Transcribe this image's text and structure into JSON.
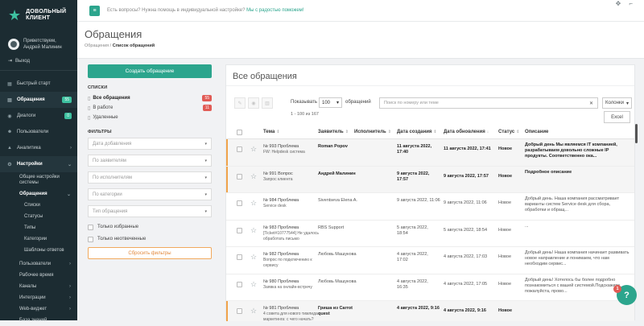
{
  "brand": {
    "line1": "ДОВОЛЬНЫЙ",
    "line2": "КЛИЕНТ"
  },
  "user": {
    "greeting": "Приветствуем,",
    "name": "Андрей Малинин",
    "logout": "Выход"
  },
  "sidebar": {
    "items": [
      {
        "label": "Быстрый старт",
        "icon": "grid-icon"
      },
      {
        "label": "Обращения",
        "icon": "inbox-icon",
        "badge": "55",
        "active": true
      },
      {
        "label": "Диалоги",
        "icon": "chat-icon",
        "badge": "0"
      },
      {
        "label": "Пользователи",
        "icon": "users-icon"
      },
      {
        "label": "Аналитика",
        "icon": "chart-icon"
      },
      {
        "label": "Настройки",
        "icon": "gear-icon",
        "active": true
      }
    ],
    "settings_sub": {
      "general": "Общие настройки системы",
      "tickets": "Обращения",
      "tickets_children": [
        "Списки",
        "Статусы",
        "Типы",
        "Категории",
        "Шаблоны ответов"
      ],
      "bottom": [
        "Пользователи",
        "Рабочее время",
        "Каналы",
        "Интеграции",
        "Web-виджет",
        "База знаний"
      ]
    }
  },
  "topbar": {
    "help_text": "Есть вопросы? Нужна помощь в индивидуальной настройке?",
    "help_link": "Мы с радостью поможем!"
  },
  "header": {
    "title": "Обращения",
    "crumb1": "Обращения",
    "crumb2": "Список обращений"
  },
  "left": {
    "create_label": "Создать обращение",
    "lists_title": "СПИСКИ",
    "lists": [
      {
        "label": "Все обращения",
        "count": "55"
      },
      {
        "label": "В работе",
        "count": "11"
      },
      {
        "label": "Удаленные",
        "count": ""
      }
    ],
    "filters_title": "ФИЛЬТРЫ",
    "filters": [
      "Дата добавления",
      "По заявителям",
      "По исполнителям",
      "По категории",
      "Тип обращения"
    ],
    "only_fav": "Только избранные",
    "only_unanswered": "Только неотвеченные",
    "reset_label": "Сбросить фильтры"
  },
  "panel": {
    "title": "Все обращения",
    "show_label": "Показывать",
    "show_value": "100",
    "show_unit": "обращений",
    "range_text": "1 - 100 из 167",
    "search_placeholder": "Поиск по номеру или теме",
    "columns_label": "Колонки",
    "excel_label": "Excel",
    "headers": {
      "subject": "Тема",
      "requester": "Заявитель",
      "executor": "Исполнитель",
      "created": "Дата создания",
      "updated": "Дата обновления",
      "status": "Статус",
      "description": "Описание"
    }
  },
  "rows": [
    {
      "num": "№ 993 Проблема",
      "subj": "FW: Helpdesk система",
      "req": "Roman Popov",
      "exe": "",
      "created": "11 августа 2022, 17:40",
      "updated": "11 августа 2022, 17:41",
      "status": "Новое",
      "desc": "Добрый день Мы являемся IT компанией, разрабатываем довольно сложные IP продукты. Соответственно ока...",
      "flag": true,
      "unread": true
    },
    {
      "num": "№ 991 Вопрос",
      "subj": "Запрос клиента",
      "req": "Андрей Малинин",
      "exe": "",
      "created": "9 августа 2022, 17:57",
      "updated": "9 августа 2022, 17:57",
      "status": "Новое",
      "desc": "Подробное описание",
      "flag": true,
      "unread": true
    },
    {
      "num": "№ 984 Проблема",
      "subj": "Service desk",
      "req": "Siventseva Elena A.",
      "exe": "",
      "created": "9 августа 2022, 11:06",
      "updated": "9 августа 2022, 11:06",
      "status": "Новое",
      "desc": "Добрый день. Наша компания рассматривает варианты систем Service desk для сбора, обработки и обращ...",
      "flag": false,
      "unread": false
    },
    {
      "num": "№ 983 Проблема",
      "subj": "[Ticket#10777544] Не удалось обработать письмо",
      "req": "RBS Support",
      "exe": "",
      "created": "5 августа 2022, 18:54",
      "updated": "5 августа 2022, 18:54",
      "status": "Новое",
      "desc": "...",
      "flag": false,
      "unread": false
    },
    {
      "num": "№ 982 Проблема",
      "subj": "Вопрос по подключению к сервису",
      "req": "Любовь Машукова",
      "exe": "",
      "created": "4 августа 2022, 17:02",
      "updated": "4 августа 2022, 17:03",
      "status": "Новое",
      "desc": "Добрый день! Наша компания начинает развивать новое направление и понимаем, что нам необходим сервис...",
      "flag": false,
      "unread": false
    },
    {
      "num": "№ 980 Проблема",
      "subj": "Заявка на онлайн-встречу",
      "req": "Любовь Машукова",
      "exe": "",
      "created": "4 августа 2022, 16:35",
      "updated": "4 августа 2022, 17:05",
      "status": "Новое",
      "desc": "Добрый день! Хотелось бы более подробно познакомиться с вашей системой.Подскажите, пожалуйста, прово...",
      "flag": false,
      "unread": false
    },
    {
      "num": "№ 981 Проблема",
      "subj": "4 совета для нового тимлида маркетинга: с чего начать?",
      "req": "Гриша из Carrot quest",
      "exe": "",
      "created": "4 августа 2022, 9:16",
      "updated": "4 августа 2022, 9:16",
      "status": "Новое",
      "desc": "",
      "flag": true,
      "unread": true
    }
  ],
  "help_fab": {
    "label": "?",
    "badge": "1"
  }
}
